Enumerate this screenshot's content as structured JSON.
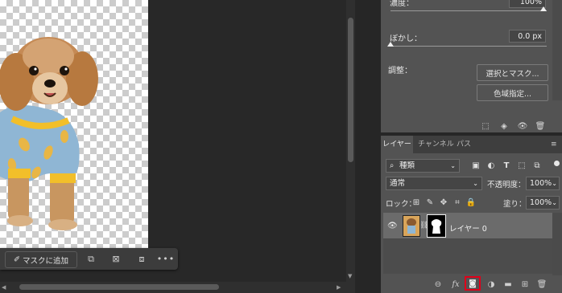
{
  "canvas": {
    "taskbar": {
      "mask_add_label": "マスクに追加",
      "more_label": "•••"
    }
  },
  "properties": {
    "density_label": "濃度：",
    "density_value": "100%",
    "feather_label": "ぼかし：",
    "feather_value": "0.0 px",
    "adjust_label": "調整：",
    "select_mask_button": "選択とマスク...",
    "color_range_button": "色域指定..."
  },
  "layers_panel": {
    "tabs": [
      "レイヤー",
      "チャンネル",
      "パス"
    ],
    "filter_kind": "種類",
    "blend_mode": "通常",
    "opacity_label": "不透明度：",
    "opacity_value": "100%",
    "lock_label": "ロック：",
    "fill_label": "塗り：",
    "fill_value": "100%",
    "layer_name": "レイヤー 0",
    "footer_fx": "fx",
    "highlight_color": "#e0001a"
  }
}
